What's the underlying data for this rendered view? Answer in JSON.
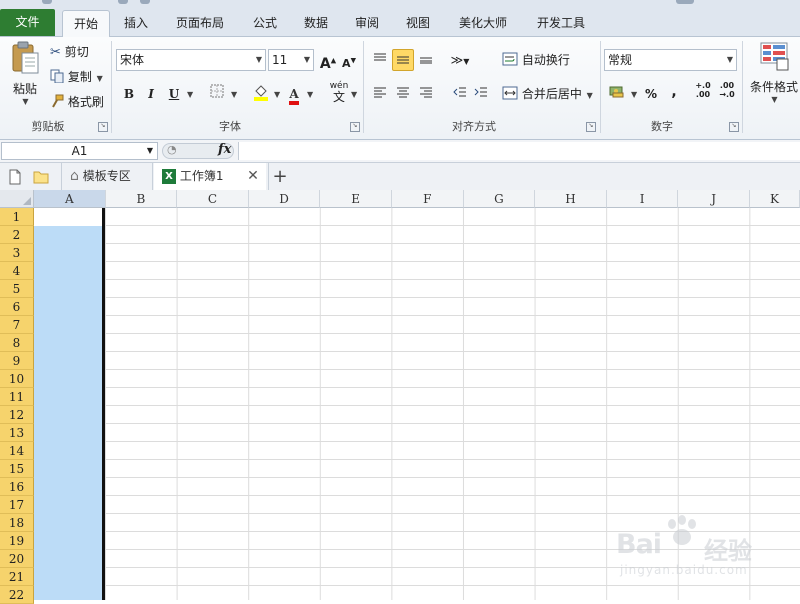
{
  "ribbon_tabs": [
    {
      "label": "文件"
    },
    {
      "label": "开始"
    },
    {
      "label": "插入"
    },
    {
      "label": "页面布局"
    },
    {
      "label": "公式"
    },
    {
      "label": "数据"
    },
    {
      "label": "审阅"
    },
    {
      "label": "视图"
    },
    {
      "label": "美化大师"
    },
    {
      "label": "开发工具"
    }
  ],
  "active_tab": "开始",
  "clipboard": {
    "paste": "粘贴",
    "cut": "剪切",
    "copy": "复制",
    "format_painter": "格式刷",
    "group_label": "剪贴板"
  },
  "font": {
    "name": "宋体",
    "size": "11",
    "bold": "B",
    "italic": "I",
    "underline": "U",
    "font_color_letter": "A",
    "phonetic": "wén",
    "group_label": "字体"
  },
  "alignment": {
    "wrap_text": "自动换行",
    "merge_center": "合并后居中",
    "group_label": "对齐方式"
  },
  "number": {
    "format": "常规",
    "percent": "%",
    "comma": ",",
    "inc_decimal": "+.0\n.00",
    "dec_decimal": ".00\n→.0",
    "group_label": "数字"
  },
  "styles": {
    "conditional_format": "条件格式"
  },
  "formula_bar": {
    "name_box": "A1",
    "fx": "fx",
    "value": ""
  },
  "doc_tabs": [
    {
      "label": "模板专区"
    },
    {
      "label": "工作簿1"
    }
  ],
  "columns": [
    "A",
    "B",
    "C",
    "D",
    "E",
    "F",
    "G",
    "H",
    "I",
    "J",
    "K"
  ],
  "rows": [
    "1",
    "2",
    "3",
    "4",
    "5",
    "6",
    "7",
    "8",
    "9",
    "10",
    "11",
    "12",
    "13",
    "14",
    "15",
    "16",
    "17",
    "18",
    "19",
    "20",
    "21",
    "22"
  ],
  "selection": {
    "column": "A",
    "active_cell": "A1"
  },
  "colors": {
    "file_tab": "#2e7d32",
    "row_header": "#f6d36c",
    "selected_column": "#bcdcf7",
    "highlight_button": "#ffd966"
  },
  "watermark": {
    "brand": "Bai",
    "brand_cn": "经验",
    "url": "jingyan.baidu.com"
  }
}
